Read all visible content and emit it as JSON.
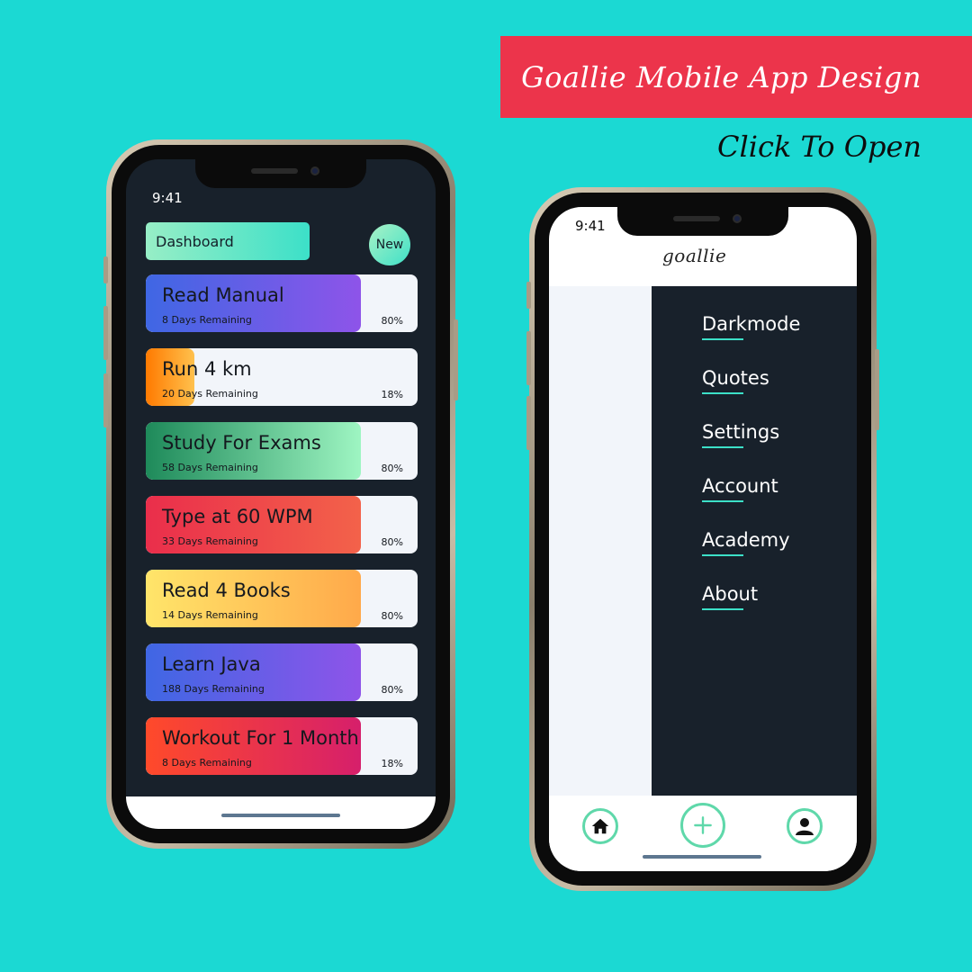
{
  "header": {
    "banner_title": "Goallie Mobile App Design",
    "subtitle": "Click To Open"
  },
  "phone_left": {
    "time": "9:41",
    "dashboard_label": "Dashboard",
    "new_label": "New",
    "goals": [
      {
        "title": "Read  Manual",
        "remaining": "8 Days Remaining",
        "percent": "80%",
        "progress": 0.79,
        "color_start": "#3f67e4",
        "color_end": "#8e54e9"
      },
      {
        "title": "Run 4 km",
        "remaining": "20 Days Remaining",
        "percent": "18%",
        "progress": 0.18,
        "color_start": "#ff7a00",
        "color_end": "#ffc14d"
      },
      {
        "title": "Study For Exams",
        "remaining": "58 Days Remaining",
        "percent": "80%",
        "progress": 0.79,
        "color_start": "#1e8a5a",
        "color_end": "#9ef5c2"
      },
      {
        "title": "Type at 60 WPM",
        "remaining": "33 Days Remaining",
        "percent": "80%",
        "progress": 0.79,
        "color_start": "#ea2e4b",
        "color_end": "#f3624a"
      },
      {
        "title": "Read 4 Books",
        "remaining": "14 Days Remaining",
        "percent": "80%",
        "progress": 0.79,
        "color_start": "#ffe56a",
        "color_end": "#ffa94a"
      },
      {
        "title": "Learn Java",
        "remaining": "188 Days Remaining",
        "percent": "80%",
        "progress": 0.79,
        "color_start": "#3f67e4",
        "color_end": "#8e54e9"
      },
      {
        "title": "Workout For 1 Month",
        "remaining": "8 Days Remaining",
        "percent": "18%",
        "progress": 0.79,
        "color_start": "#ff4a2a",
        "color_end": "#d61f6b"
      }
    ]
  },
  "phone_right": {
    "time": "9:41",
    "logo": "goallie",
    "menu": [
      "Darkmode",
      "Quotes",
      "Settings",
      "Account",
      "Academy",
      "About"
    ],
    "tabbar": {
      "home": "home-icon",
      "add": "plus-icon",
      "profile": "user-icon"
    }
  }
}
